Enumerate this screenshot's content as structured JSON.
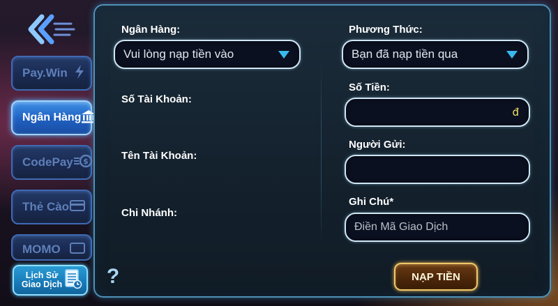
{
  "sidebar": {
    "tabs": [
      {
        "label": "Pay.Win",
        "icon": "lightning-icon",
        "active": false
      },
      {
        "label": "Ngân Hàng",
        "icon": "bank-icon",
        "active": true
      },
      {
        "label": "CodePay",
        "icon": "coin-icon",
        "active": false
      },
      {
        "label": "Thẻ Cào",
        "icon": "card-icon",
        "active": false
      },
      {
        "label": "MOMO",
        "icon": "wallet-icon",
        "active": false
      }
    ],
    "history_label_line1": "Lịch Sử",
    "history_label_line2": "Giao Dịch"
  },
  "form": {
    "bank_label": "Ngân Hàng:",
    "bank_select_value": "Vui lòng nạp tiền vào",
    "account_number_label": "Số Tài Khoản:",
    "account_name_label": "Tên Tài Khoản:",
    "branch_label": "Chi Nhánh:",
    "method_label": "Phương Thức:",
    "method_select_value": "Bạn đã nạp tiền qua",
    "amount_label": "Số Tiền:",
    "amount_value": "",
    "currency_symbol": "đ",
    "sender_label": "Người Gửi:",
    "sender_value": "",
    "note_label": "Ghi Chú*",
    "note_placeholder": "Điền Mã Giao Dịch",
    "help_symbol": "?",
    "submit_label": "NẠP TIỀN"
  },
  "colors": {
    "accent_blue": "#39b8ee",
    "active_tab": "#1f5fc0",
    "submit_border": "#f0c96a",
    "currency": "#f2e36a"
  }
}
